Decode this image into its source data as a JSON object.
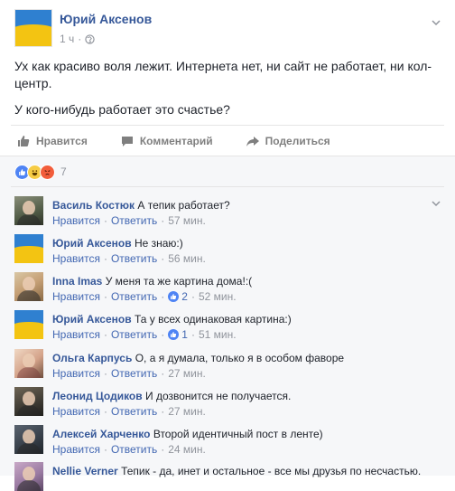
{
  "post": {
    "author": "Юрий Аксенов",
    "time": "1 ч",
    "text_line1": "Ух как красиво воля лежит. Интернета нет, ни сайт не работает, ни кол-",
    "text_line2": "центр.",
    "text_line3": "У кого-нибудь работает это счастье?"
  },
  "actions": {
    "like": "Нравится",
    "comment": "Комментарий",
    "share": "Поделиться"
  },
  "reactions": {
    "count": "7"
  },
  "comment_meta": {
    "like_label": "Нравится",
    "reply_label": "Ответить"
  },
  "comments": [
    {
      "name": "Василь Костюк",
      "text": "А тепик работает?",
      "time": "57 мин.",
      "likes": ""
    },
    {
      "name": "Юрий Аксенов",
      "text": "Не знаю:)",
      "time": "56 мин.",
      "likes": ""
    },
    {
      "name": "Inna Imas",
      "text": "У меня та же картина дома!:(",
      "time": "52 мин.",
      "likes": "2"
    },
    {
      "name": "Юрий Аксенов",
      "text": "Та у всех одинаковая картина:)",
      "time": "51 мин.",
      "likes": "1"
    },
    {
      "name": "Ольга Карпусь",
      "text": "О, а я думала, только я в особом фаворе",
      "time": "27 мин.",
      "likes": ""
    },
    {
      "name": "Леонид Цодиков",
      "text": "И дозвонится не получается.",
      "time": "27 мин.",
      "likes": ""
    },
    {
      "name": "Алексей Харченко",
      "text": "Второй идентичный пост в ленте)",
      "time": "24 мин.",
      "likes": ""
    },
    {
      "name": "Nellie Verner",
      "text": "Тепик - да, инет и остальное - все мы друзья по несчастью.",
      "time": "",
      "likes": ""
    }
  ],
  "colors": {
    "link": "#365899",
    "meta": "#90949c",
    "like_blue": "#4f84f4"
  }
}
